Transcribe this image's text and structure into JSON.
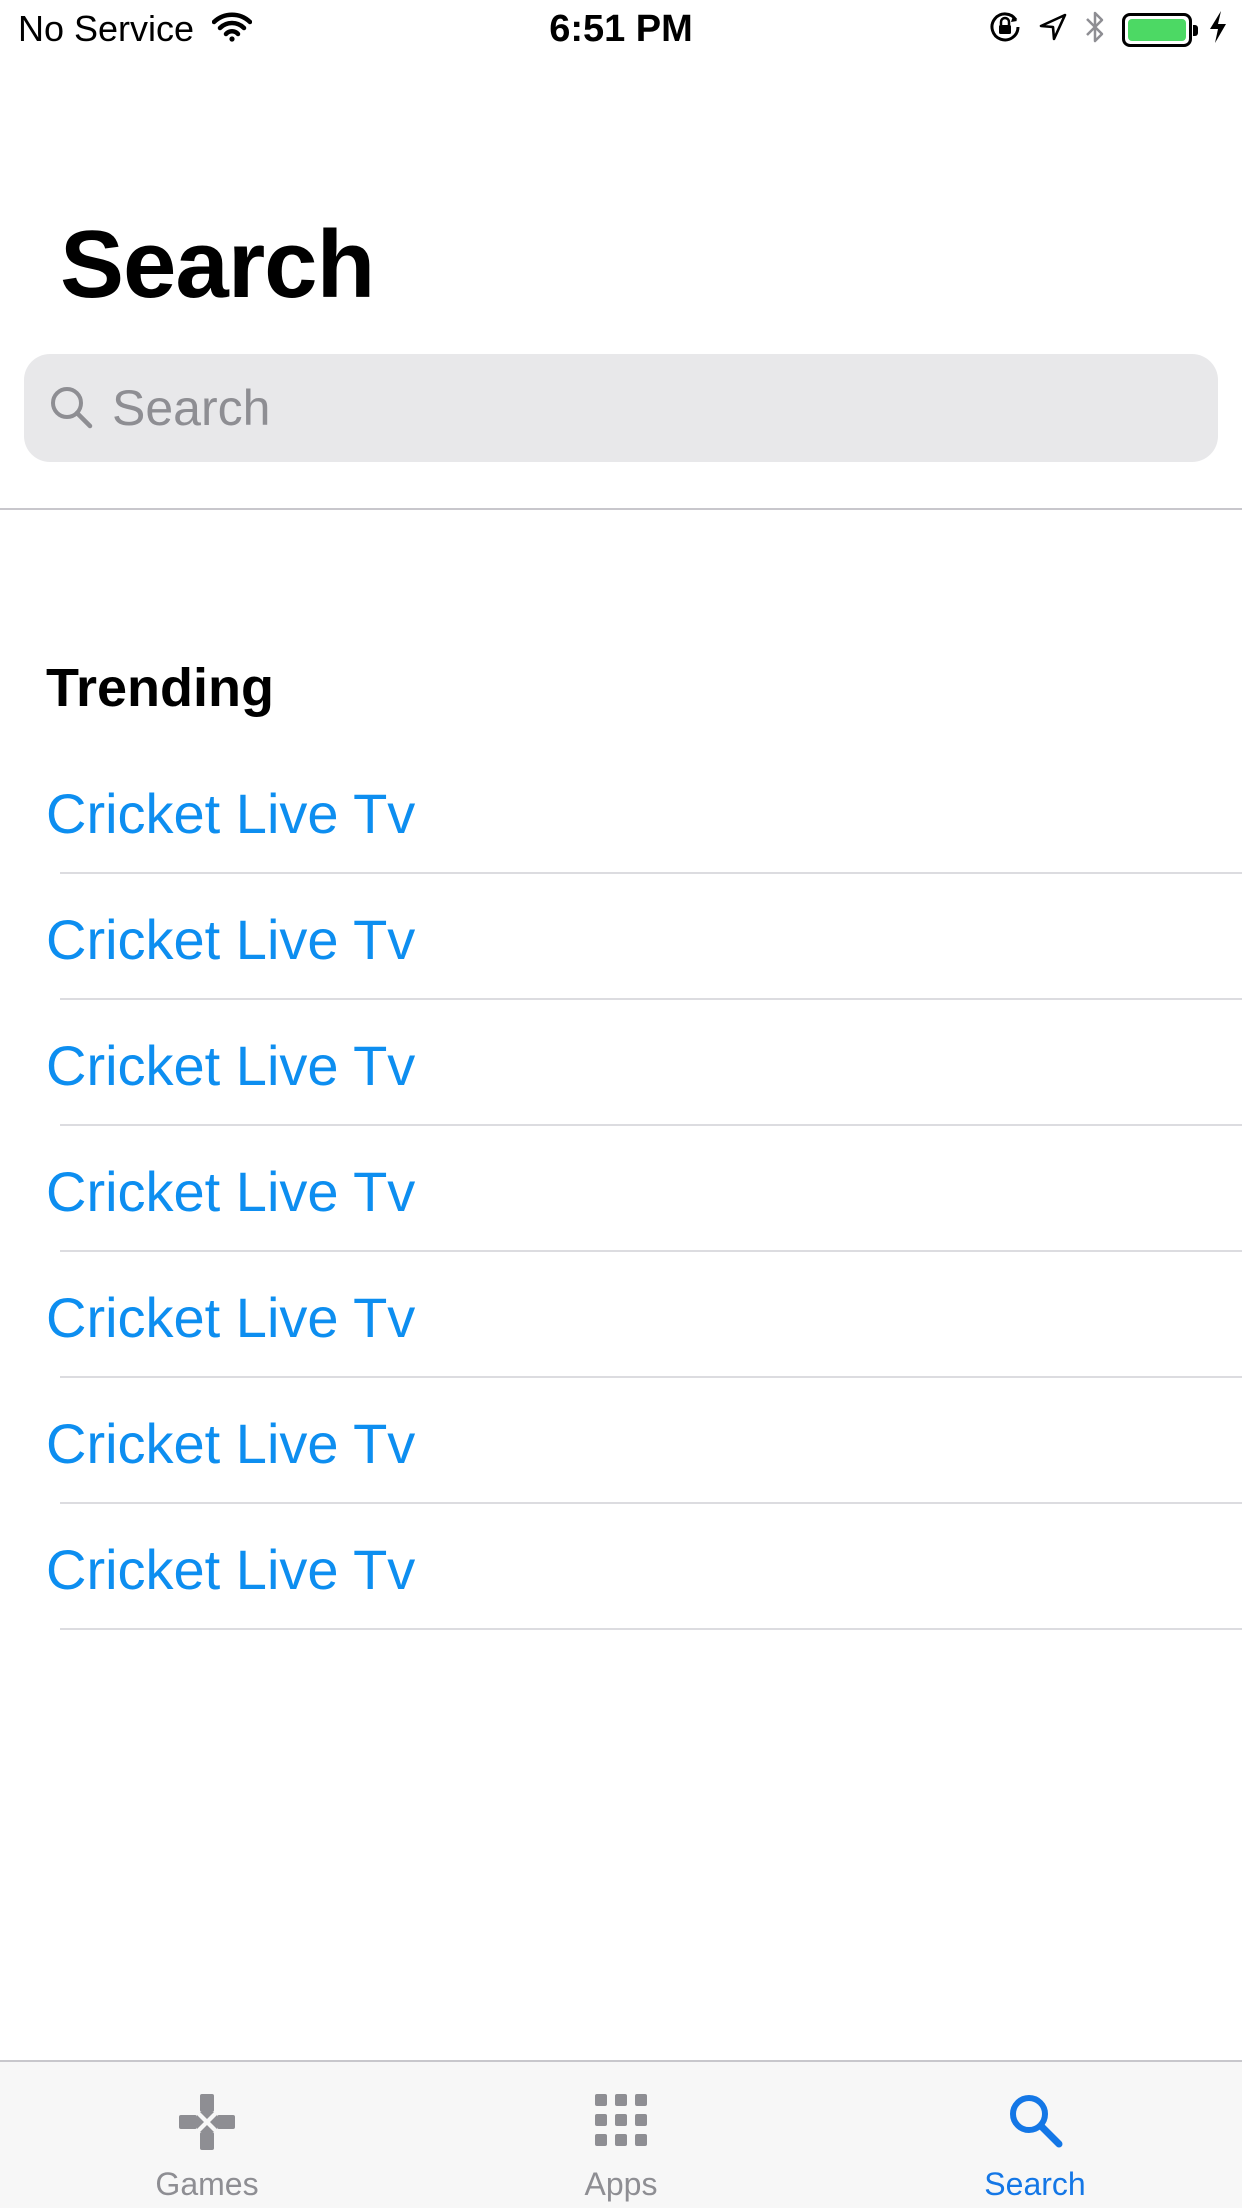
{
  "status_bar": {
    "carrier": "No Service",
    "time": "6:51 PM",
    "battery_color": "#4cd964"
  },
  "page": {
    "title": "Search"
  },
  "search": {
    "placeholder": "Search",
    "value": ""
  },
  "trending": {
    "title": "Trending",
    "items": [
      "Cricket Live Tv",
      "Cricket Live Tv",
      "Cricket Live Tv",
      "Cricket Live Tv",
      "Cricket Live Tv",
      "Cricket Live Tv",
      "Cricket Live Tv"
    ]
  },
  "tabs": [
    {
      "label": "Games",
      "icon": "gamepad-icon",
      "active": false
    },
    {
      "label": "Apps",
      "icon": "apps-grid-icon",
      "active": false
    },
    {
      "label": "Search",
      "icon": "search-icon",
      "active": true
    }
  ],
  "colors": {
    "accent": "#0d8ef0",
    "tab_active": "#1477e6",
    "tab_inactive": "#8e8e93"
  }
}
